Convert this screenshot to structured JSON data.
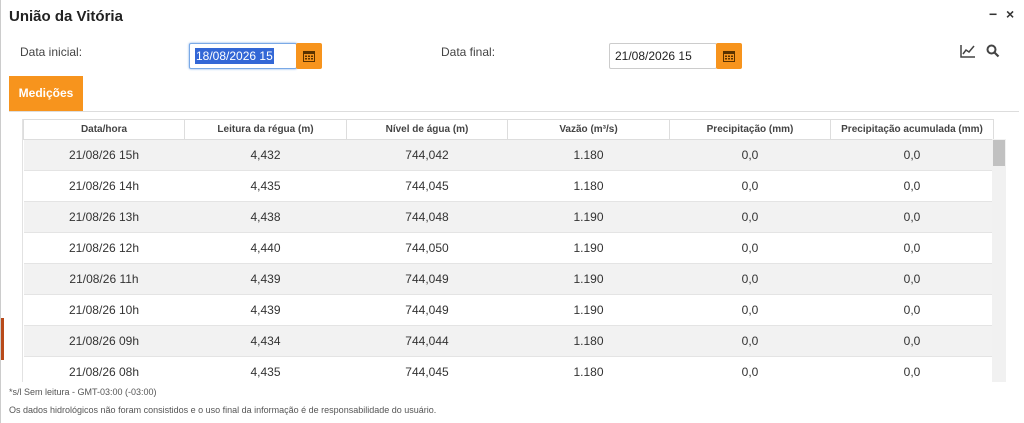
{
  "window": {
    "title": "União da Vitória",
    "minimize_glyph": "−",
    "close_glyph": "×"
  },
  "filters": {
    "start_label": "Data inicial:",
    "start_value": "18/08/2026 15",
    "end_label": "Data final:",
    "end_value": "21/08/2026 15"
  },
  "icons": {
    "calendar": "calendar-icon",
    "chart": "line-chart-icon",
    "search": "search-icon"
  },
  "tabs": [
    {
      "label": "Medições"
    }
  ],
  "table": {
    "headers": [
      "Data/hora",
      "Leitura da régua (m)",
      "Nível de água (m)",
      "Vazão (m³/s)",
      "Precipitação (mm)",
      "Precipitação acumulada (mm)"
    ],
    "rows": [
      [
        "21/08/26 15h",
        "4,432",
        "744,042",
        "1.180",
        "0,0",
        "0,0"
      ],
      [
        "21/08/26 14h",
        "4,435",
        "744,045",
        "1.180",
        "0,0",
        "0,0"
      ],
      [
        "21/08/26 13h",
        "4,438",
        "744,048",
        "1.190",
        "0,0",
        "0,0"
      ],
      [
        "21/08/26 12h",
        "4,440",
        "744,050",
        "1.190",
        "0,0",
        "0,0"
      ],
      [
        "21/08/26 11h",
        "4,439",
        "744,049",
        "1.190",
        "0,0",
        "0,0"
      ],
      [
        "21/08/26 10h",
        "4,439",
        "744,049",
        "1.190",
        "0,0",
        "0,0"
      ],
      [
        "21/08/26 09h",
        "4,434",
        "744,044",
        "1.180",
        "0,0",
        "0,0"
      ],
      [
        "21/08/26 08h",
        "4,435",
        "744,045",
        "1.180",
        "0,0",
        "0,0"
      ]
    ]
  },
  "footnotes": {
    "line1": "*s/l Sem leitura - GMT-03:00 (-03:00)",
    "line2": "Os dados hidrológicos não foram consistidos e o uso final da informação é de responsabilidade do usuário."
  },
  "colors": {
    "accent": "#f7941d",
    "selection": "#3367d6"
  }
}
